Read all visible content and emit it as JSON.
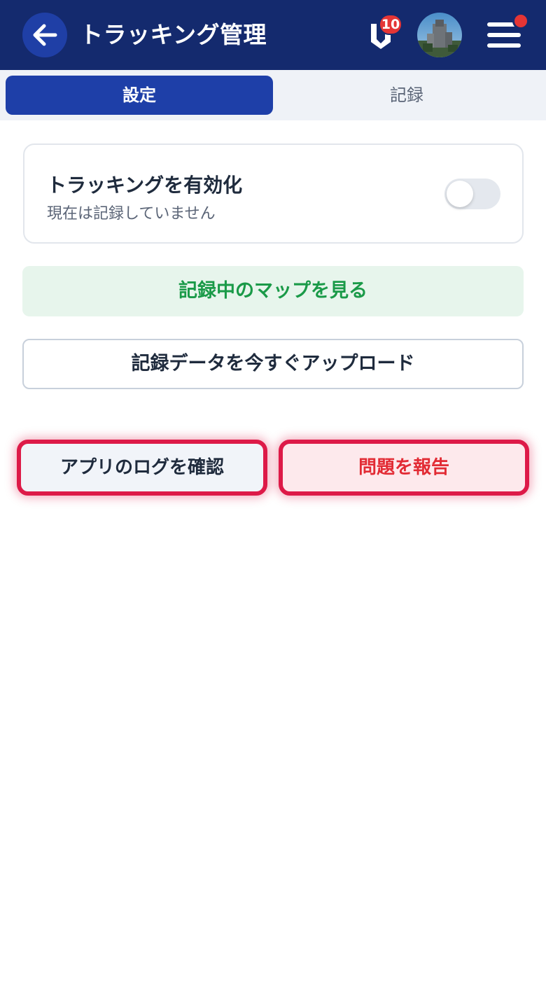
{
  "header": {
    "title": "トラッキング管理",
    "back_icon": "arrow-left-icon",
    "notification_count": "10",
    "menu_icon": "hamburger-menu-icon",
    "colors": {
      "bar": "#142a6e",
      "badge": "#e53535"
    }
  },
  "tabs": [
    {
      "label": "設定",
      "active": true
    },
    {
      "label": "記録",
      "active": false
    }
  ],
  "tracking_card": {
    "title": "トラッキングを有効化",
    "subtitle": "現在は記録していません",
    "toggle_on": false
  },
  "buttons": {
    "view_map": "記録中のマップを見る",
    "upload_now": "記録データを今すぐアップロード",
    "view_logs": "アプリのログを確認",
    "report_issue": "問題を報告"
  },
  "colors": {
    "accent": "#1e3fa8",
    "green_text": "#1a9a48",
    "highlight_border": "#dd1a48",
    "report_text": "#e22b34"
  }
}
